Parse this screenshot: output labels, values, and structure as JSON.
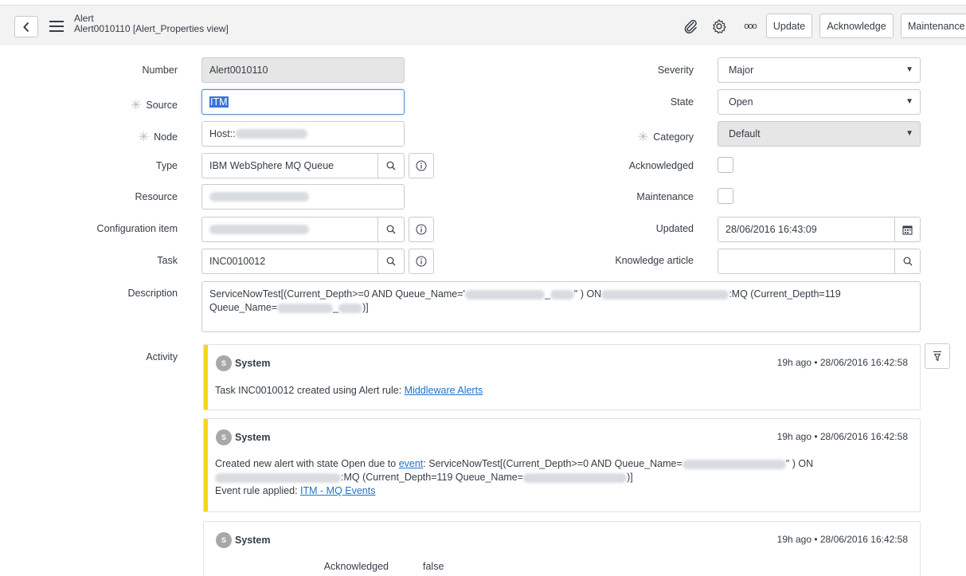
{
  "header": {
    "title": "Alert",
    "subtitle": "Alert0010110 [Alert_Properties view]",
    "buttons": {
      "update": "Update",
      "acknowledge": "Acknowledge",
      "maintenance": "Maintenance"
    },
    "more_glyph": "ooo"
  },
  "form": {
    "number": {
      "label": "Number",
      "value": "Alert0010110"
    },
    "source": {
      "label": "Source",
      "value": "ITM"
    },
    "node": {
      "label": "Node",
      "value": "Host::"
    },
    "type": {
      "label": "Type",
      "value": "IBM WebSphere MQ Queue"
    },
    "resource": {
      "label": "Resource",
      "value": ""
    },
    "configuration_item": {
      "label": "Configuration item",
      "value": ""
    },
    "task": {
      "label": "Task",
      "value": "INC0010012"
    },
    "description": {
      "label": "Description",
      "line1_a": "ServiceNowTest[(Current_Depth>=0 AND Queue_Name='",
      "line1_b": "_",
      "line1_c": "\" ) ON",
      "line1_d": ":MQ (Current_Depth=119",
      "line2_a": "Queue_Name=",
      "line2_b": "_",
      "line2_c": ")]"
    },
    "severity": {
      "label": "Severity",
      "value": "Major"
    },
    "state": {
      "label": "State",
      "value": "Open"
    },
    "category": {
      "label": "Category",
      "value": "Default"
    },
    "acknowledged": {
      "label": "Acknowledged",
      "checked": false
    },
    "maintenance": {
      "label": "Maintenance",
      "checked": false
    },
    "updated": {
      "label": "Updated",
      "value": "28/06/2016 16:43:09"
    },
    "knowledge_article": {
      "label": "Knowledge article",
      "value": ""
    }
  },
  "activity": {
    "label": "Activity",
    "entries": [
      {
        "avatar": "S",
        "author": "System",
        "timestamp": "19h ago • 28/06/2016 16:42:58",
        "text": "Task INC0010012 created using Alert rule:",
        "link": "Middleware Alerts"
      },
      {
        "avatar": "S",
        "author": "System",
        "timestamp": "19h ago • 28/06/2016 16:42:58",
        "text_a": "Created new alert with state Open due to",
        "link_event": "event",
        "text_b": ": ServiceNowTest[(Current_Depth>=0 AND Queue_Name=",
        "text_c": "\" ) ON",
        "text_d": ":MQ (Current_Depth=119 Queue_Name=",
        "text_e": ")]",
        "rule_text": "Event rule applied:",
        "rule_link": "ITM - MQ Events"
      },
      {
        "avatar": "S",
        "author": "System",
        "timestamp": "19h ago • 28/06/2016 16:42:58",
        "field_label": "Acknowledged",
        "field_value": "false"
      }
    ]
  },
  "colors": {
    "accent": "#1f72c8",
    "stripe": "#f7d51a",
    "readonly": "#e6e6e6"
  }
}
